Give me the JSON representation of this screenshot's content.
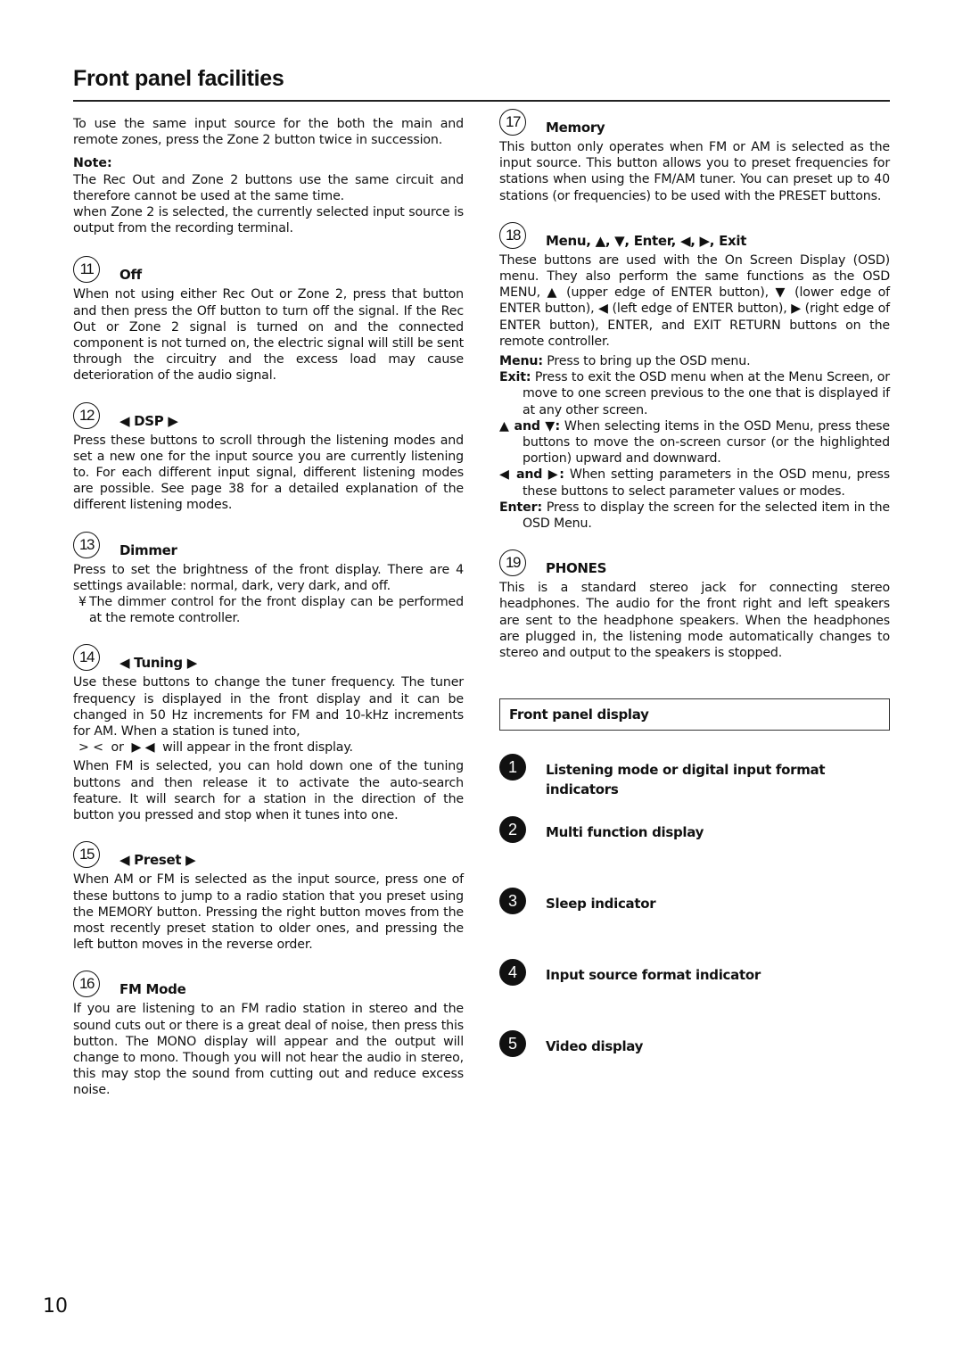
{
  "page": {
    "title": "Front panel facilities",
    "page_number": "10"
  },
  "left_column": {
    "intro": "To use the same input source for the both the main and remote zones, press the Zone 2 button twice in succession.",
    "note_label": "Note:",
    "note_lines": [
      "The Rec Out and Zone 2 buttons use the same circuit and therefore cannot be used at the same time.",
      "when Zone 2 is selected, the currently selected input source is output from the recording terminal."
    ],
    "sections": [
      {
        "number": "11",
        "title": "Off",
        "body": "When not using either Rec Out or Zone 2, press that button and then press the Off button to turn off the signal. If the Rec Out or Zone 2 signal is turned on and the connected component is not turned on, the electric signal will still be sent through the circuitry and the excess load may cause deterioration of the audio signal."
      },
      {
        "number": "12",
        "title": "◀ DSP ▶",
        "body": "Press these buttons to scroll through the listening modes and set a new one for the input source you are currently listening to. For each different input signal, different listening modes are possible. See page 38 for a detailed explanation of the different listening modes."
      },
      {
        "number": "13",
        "title": "Dimmer",
        "body": "Press to set the brightness of the front display. There are 4 settings available: normal, dark, very dark, and off.",
        "bullet_mark": "¥",
        "bullet": "The dimmer control for the front display can be performed at the remote controller."
      },
      {
        "number": "14",
        "title": "◀ Tuning ▶",
        "body": "Use these buttons to change the tuner frequency. The tuner frequency is displayed in the front display and it can be changed in 50 Hz increments for FM and 10-kHz increments for AM. When a station is tuned into,",
        "body_line2": "> <  or  ▶ ◀  will appear in the front display.",
        "body2": "When FM is selected, you can hold down one of the tuning buttons and then release it to activate the auto-search feature. It will search for a station in the direction of the button you pressed and stop when it tunes into one."
      },
      {
        "number": "15",
        "title": "◀ Preset ▶",
        "body": "When AM or FM is selected as the input source, press one of these buttons to jump to a radio station that you preset using the MEMORY button. Pressing the right button moves from the most recently preset station to older ones, and pressing the left button moves in the reverse order."
      },
      {
        "number": "16",
        "title": "FM Mode",
        "body": "If you are listening to an FM radio station in stereo and the sound cuts out or there is a great deal of noise, then press this button. The  MONO  display will appear and the output will change to mono. Though you will not hear the audio in stereo, this may stop the sound from cutting out and reduce excess noise."
      }
    ]
  },
  "right_column": {
    "sections": [
      {
        "number": "17",
        "title": "Memory",
        "body": "This button only operates when FM or AM is selected as the input source. This button allows you to preset frequencies for stations when using the FM/AM tuner. You can preset up to 40 stations (or frequencies) to be used with the PRESET buttons."
      },
      {
        "number": "18",
        "title": "Menu, ▲, ▼, Enter, ◀, ▶, Exit",
        "body": "These buttons are used with the On Screen Display (OSD) menu. They also perform the same functions as the OSD MENU, ▲ (upper edge of ENTER button), ▼ (lower edge of ENTER button), ◀ (left edge of ENTER button), ▶ (right edge of ENTER button), ENTER, and EXIT RETURN buttons on the remote controller.",
        "definitions": [
          {
            "term": "Menu:",
            "text": " Press to bring up the OSD menu."
          },
          {
            "term": "Exit:",
            "text": " Press to exit the OSD menu when at the Menu Screen, or move to one screen previous to the one that is displayed if at any other screen."
          },
          {
            "term": "▲ and ▼:",
            "text": " When selecting items in the OSD Menu, press these buttons to move the on-screen cursor (or the highlighted portion) upward and downward."
          },
          {
            "term": "◀ and ▶:",
            "text": " When setting parameters in the OSD menu, press these buttons to select parameter values or modes."
          },
          {
            "term": "Enter:",
            "text": " Press to display the screen for the selected item in the OSD Menu."
          }
        ]
      },
      {
        "number": "19",
        "title": "PHONES",
        "body": "This is a standard stereo jack for connecting stereo headphones. The audio for the front right and left speakers are sent to the headphone speakers. When the headphones are plugged in, the listening mode automatically changes to stereo and output to the speakers is stopped."
      }
    ],
    "display_box_title": "Front panel display",
    "display_items": [
      {
        "number": "1",
        "label": "Listening mode or digital input format indicators"
      },
      {
        "number": "2",
        "label": "Multi function display"
      },
      {
        "number": "3",
        "label": "Sleep indicator"
      },
      {
        "number": "4",
        "label": "Input source format indicator"
      },
      {
        "number": "5",
        "label": "Video display"
      }
    ]
  }
}
